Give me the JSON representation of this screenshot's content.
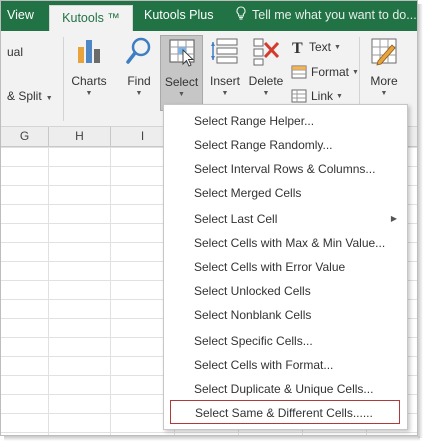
{
  "tabs": {
    "view": "View",
    "kutools": "Kutools ™",
    "kutools_plus": "Kutools Plus",
    "tell_me": "Tell me what you want to do..."
  },
  "ribbon": {
    "partial_top": "ual",
    "partial_split": "& Split",
    "charts": "Charts",
    "find": "Find",
    "select": "Select",
    "insert": "Insert",
    "delete": "Delete",
    "text": "Text",
    "format": "Format",
    "link": "Link",
    "more": "More"
  },
  "columns": [
    "G",
    "H",
    "I"
  ],
  "select_menu": {
    "items": [
      "Select Range Helper...",
      "Select Range Randomly...",
      "Select Interval Rows & Columns...",
      "Select Merged Cells",
      "Select Last Cell",
      "Select Cells with Max & Min Value...",
      "Select Cells with Error Value",
      "Select Unlocked Cells",
      "Select Nonblank Cells",
      "Select Specific Cells...",
      "Select Cells with Format...",
      "Select Duplicate & Unique Cells...",
      "Select Same & Different Cells......"
    ],
    "submenu_item": "Select Last Cell",
    "highlighted_item": "Select Same & Different Cells......"
  },
  "colors": {
    "tab_bar": "#217346",
    "ribbon_bg": "#f2f2f2",
    "highlight_border": "#b03a3a"
  }
}
